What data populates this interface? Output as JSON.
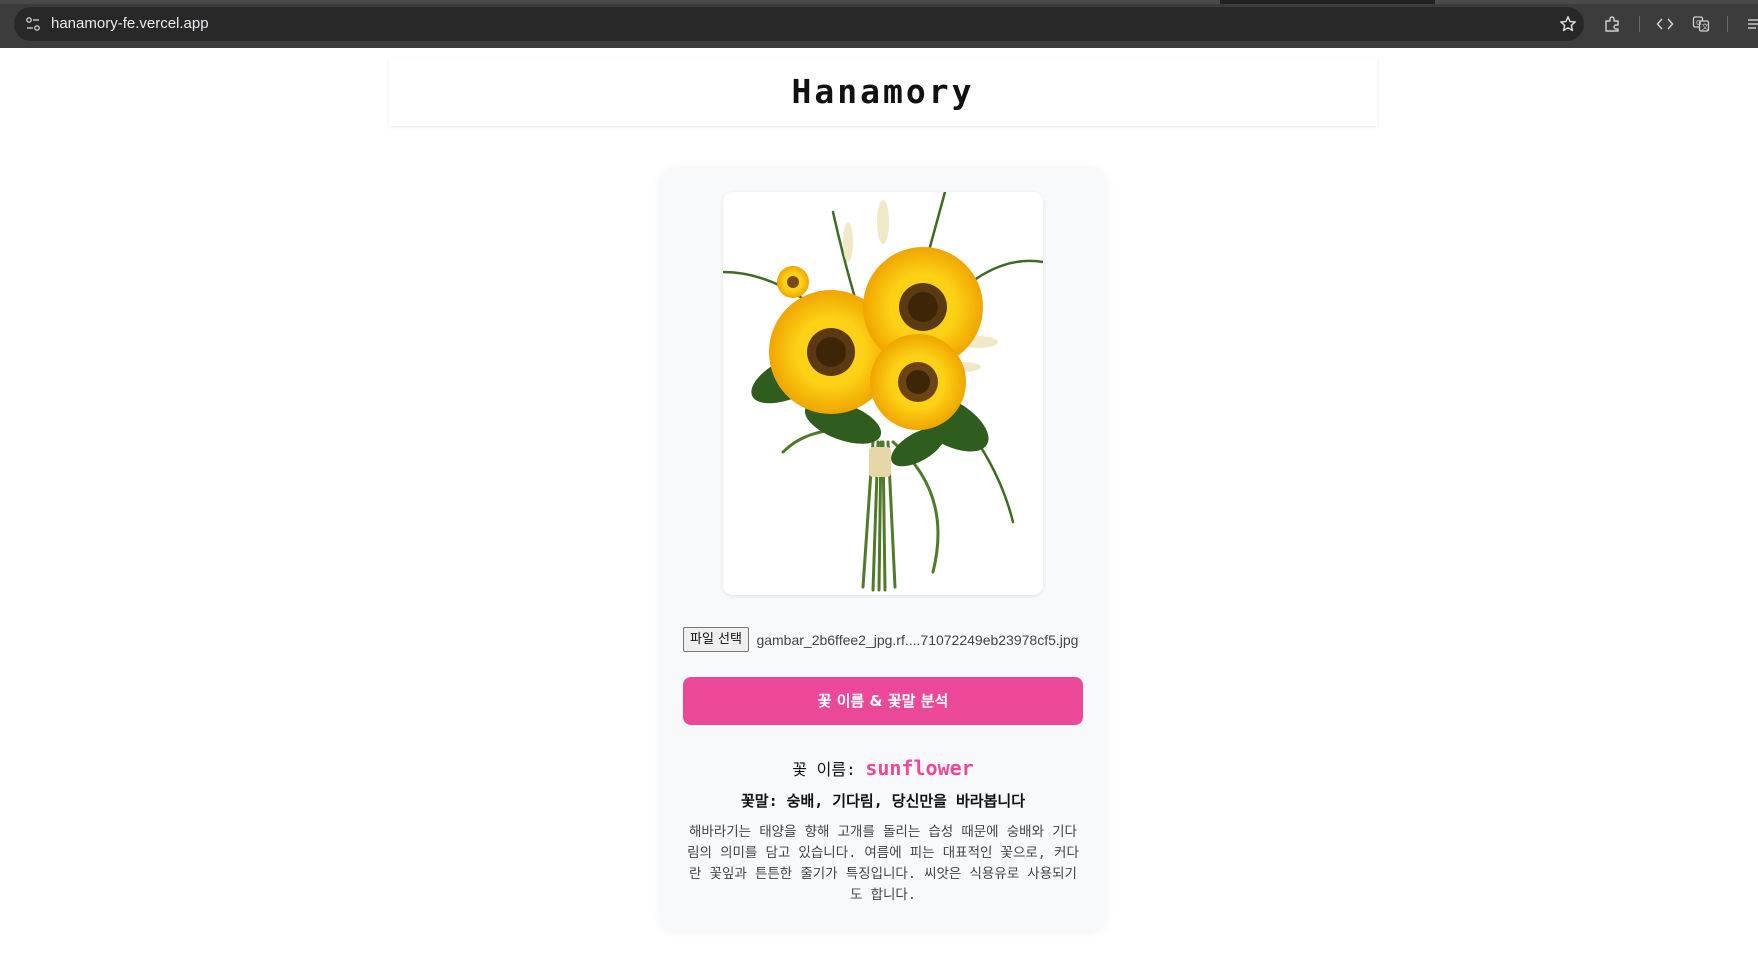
{
  "browser": {
    "url": "hanamory-fe.vercel.app",
    "icons": [
      "site-info-icon",
      "bookmark-star-icon",
      "extensions-icon",
      "devtools-icon",
      "translate-icon",
      "side-panel-icon"
    ]
  },
  "header": {
    "title": "Hanamory"
  },
  "upload": {
    "choose_file_label": "파일 선택",
    "file_name": "gambar_2b6ffee2_jpg.rf....71072249eb23978cf5.jpg"
  },
  "analyze_button_label": "꽃 이름 & 꽃말 분석",
  "result": {
    "name_label": "꽃 이름:",
    "name_value": "sunflower",
    "meaning": "꽃말: 숭배, 기다림, 당신만을 바라봅니다",
    "description": "해바라기는 태양을 향해 고개를 돌리는 습성 때문에 숭배와 기다림의 의미를 담고 있습니다. 여름에 피는 대표적인 꽃으로, 커다란 꽃잎과 튼튼한 줄기가 특징입니다. 씨앗은 식용유로 사용되기도 합니다."
  },
  "colors": {
    "accent": "#ec4899",
    "card_background": "#f8f9fb",
    "browser_bar": "#3c3c3c"
  }
}
